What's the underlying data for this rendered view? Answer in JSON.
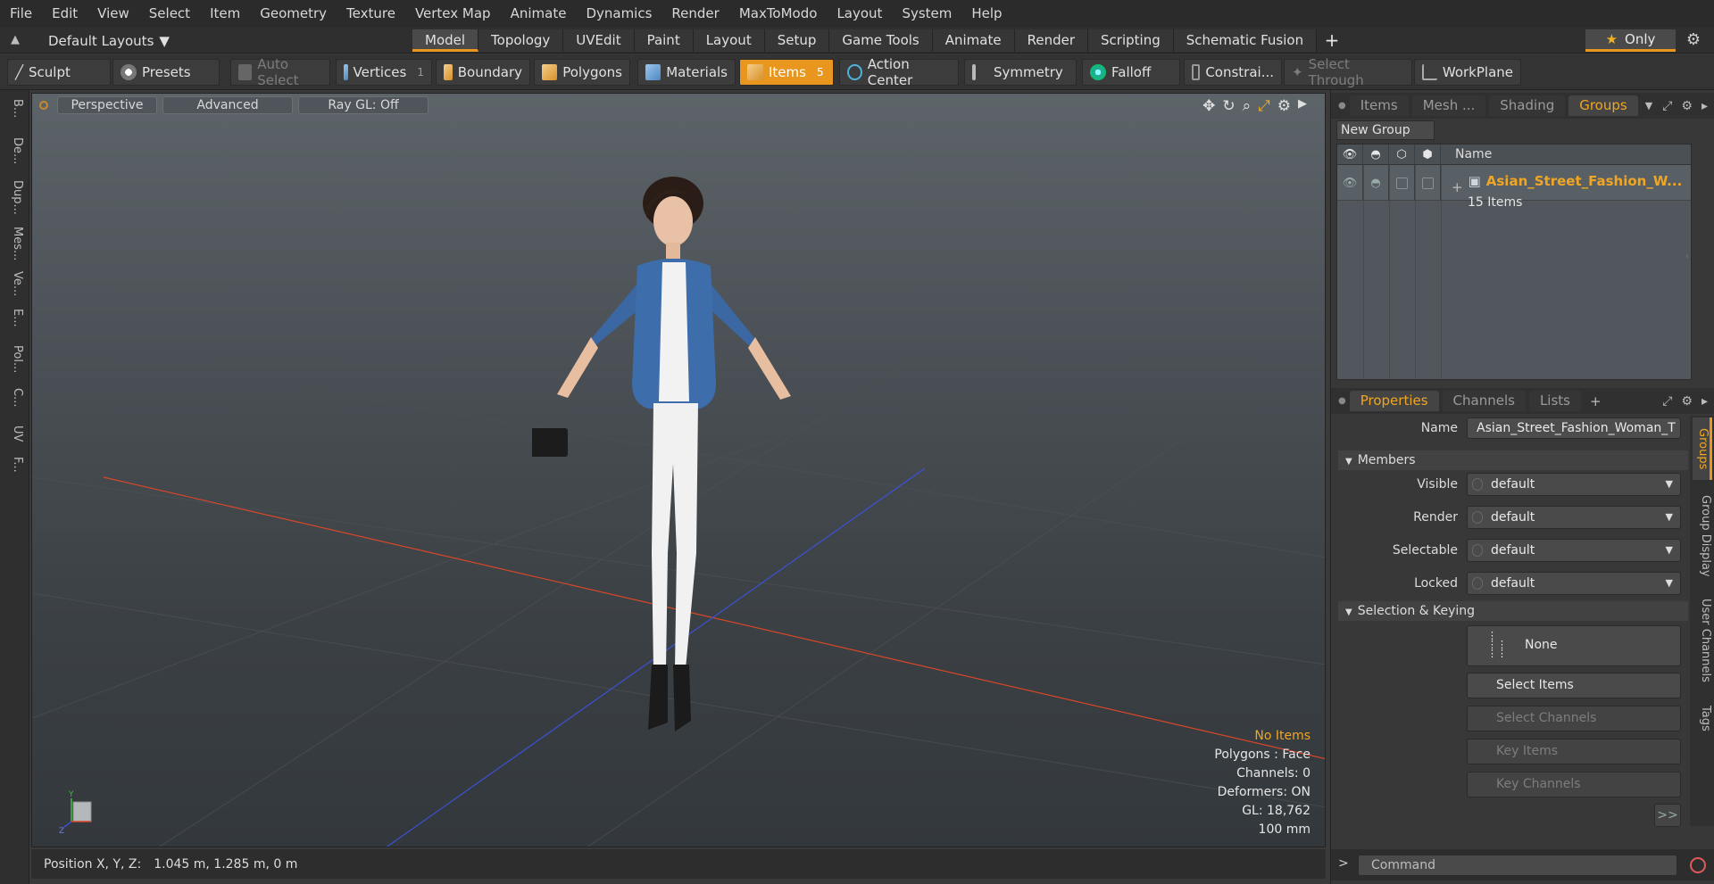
{
  "menu": [
    "File",
    "Edit",
    "View",
    "Select",
    "Item",
    "Geometry",
    "Texture",
    "Vertex Map",
    "Animate",
    "Dynamics",
    "Render",
    "MaxToModo",
    "Layout",
    "System",
    "Help"
  ],
  "layoutbar": {
    "layout_name": "Default Layouts",
    "tabs": [
      "Model",
      "Topology",
      "UVEdit",
      "Paint",
      "Layout",
      "Setup",
      "Game Tools",
      "Animate",
      "Render",
      "Scripting",
      "Schematic Fusion"
    ],
    "active_tab": "Model",
    "only_label": "Only"
  },
  "toolbar": {
    "sculpt": "Sculpt",
    "presets": "Presets",
    "auto_select": "Auto Select",
    "vertices": "Vertices",
    "vertices_count": "1",
    "boundary": "Boundary",
    "polygons": "Polygons",
    "materials": "Materials",
    "items": "Items",
    "items_count": "5",
    "action_center": "Action Center",
    "symmetry": "Symmetry",
    "falloff": "Falloff",
    "constraints": "Constrai...",
    "select_through": "Select Through",
    "workplane": "WorkPlane"
  },
  "left_tabs": [
    "B...",
    "De...",
    "Dup...",
    "Mes...",
    "Ve...",
    "E...",
    "Pol...",
    "C...",
    "UV",
    "F..."
  ],
  "viewport": {
    "view_mode": "Perspective",
    "shading": "Advanced",
    "raygl": "Ray GL: Off",
    "info": {
      "selection": "No Items",
      "polygons": "Polygons : Face",
      "channels": "Channels: 0",
      "deformers": "Deformers: ON",
      "gl": "GL: 18,762",
      "scale": "100 mm"
    },
    "axis_labels": {
      "y": "Y",
      "z": "Z"
    }
  },
  "status": {
    "label": "Position X, Y, Z:",
    "value": "1.045 m, 1.285 m, 0 m"
  },
  "groups_panel": {
    "tabs": [
      "Items",
      "Mesh ...",
      "Shading",
      "Groups"
    ],
    "active_tab": "Groups",
    "new_group": "New Group",
    "name_header": "Name",
    "group_name": "Asian_Street_Fashion_W...",
    "group_count": "15 Items"
  },
  "properties_panel": {
    "tabs": [
      "Properties",
      "Channels",
      "Lists"
    ],
    "active_tab": "Properties",
    "name_label": "Name",
    "name_value": "Asian_Street_Fashion_Woman_T",
    "members_section": "Members",
    "visible_label": "Visible",
    "visible_value": "default",
    "render_label": "Render",
    "render_value": "default",
    "selectable_label": "Selectable",
    "selectable_value": "default",
    "locked_label": "Locked",
    "locked_value": "default",
    "keying_section": "Selection & Keying",
    "none_label": "None",
    "select_items": "Select Items",
    "select_channels": "Select Channels",
    "key_items": "Key Items",
    "key_channels": "Key Channels",
    "more": ">>",
    "side_tabs": [
      "Groups",
      "Group Display",
      "User Channels",
      "Tags"
    ]
  },
  "command": {
    "prompt": ">",
    "placeholder": "Command"
  },
  "colors": {
    "accent": "#e8961e",
    "highlight_text": "#f0a623",
    "x_axis": "#d9462a",
    "z_axis": "#3a52d6"
  }
}
